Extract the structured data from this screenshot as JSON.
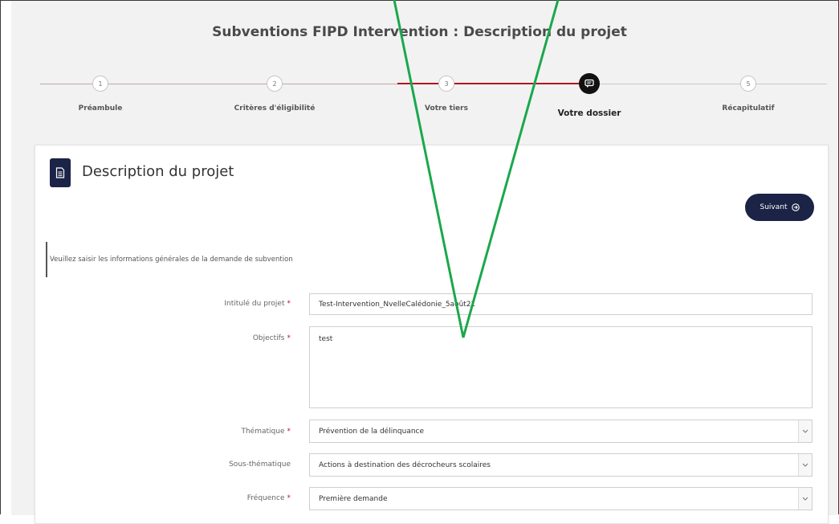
{
  "page": {
    "title": "Subventions FIPD Intervention : Description du projet"
  },
  "stepper": {
    "steps": [
      {
        "number": "1",
        "label": "Préambule"
      },
      {
        "number": "2",
        "label": "Critères d'éligibilité"
      },
      {
        "number": "3",
        "label": "Votre tiers"
      },
      {
        "number": "",
        "label": "Votre dossier",
        "active": true,
        "icon": "chat-icon"
      },
      {
        "number": "5",
        "label": "Récapitulatif"
      }
    ]
  },
  "card": {
    "icon": "document-icon",
    "title": "Description du projet",
    "next_button": "Suivant",
    "info_text": "Veuillez saisir les informations générales de la demande de subvention"
  },
  "form": {
    "fields": [
      {
        "label": "Intitulé du projet",
        "required": true,
        "value": "Test-Intervention_NvelleCalédonie_5août21",
        "type": "text"
      },
      {
        "label": "Objectifs",
        "required": true,
        "value": "test",
        "type": "textarea"
      },
      {
        "label": "Thématique",
        "required": true,
        "value": "Prévention de la délinquance",
        "type": "select"
      },
      {
        "label": "Sous-thématique",
        "required": false,
        "value": "Actions à destination des décrocheurs scolaires",
        "type": "select"
      },
      {
        "label": "Fréquence",
        "required": true,
        "value": "Première demande",
        "type": "select"
      }
    ]
  },
  "colors": {
    "brand": "#1b2446",
    "progress": "#b0121f",
    "required": "#c8102e",
    "annotation": "#1aa84c"
  }
}
